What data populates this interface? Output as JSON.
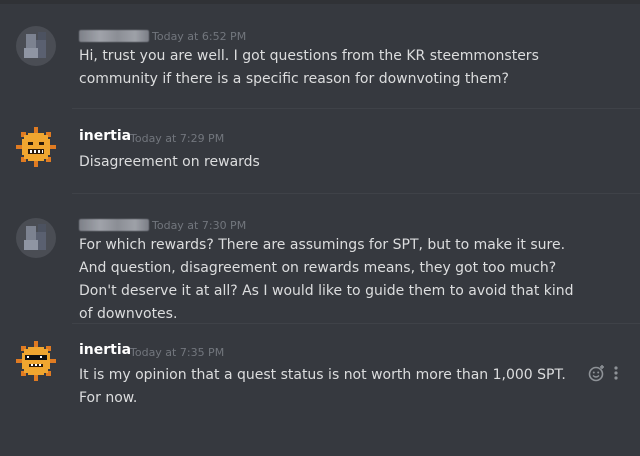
{
  "messages": [
    {
      "author": "",
      "timestamp": "Today at 6:52 PM",
      "lines": [
        "Hi, trust you are well. I got questions from the KR steemmonsters community if there is a specific reason for downvoting them?"
      ]
    },
    {
      "author": "inertia",
      "timestamp": "Today at 7:29 PM",
      "lines": [
        "Disagreement on rewards"
      ]
    },
    {
      "author": "",
      "timestamp": "Today at 7:30 PM",
      "lines": [
        "For which rewards? There are assumings for SPT, but to make it sure.",
        "And question, disagreement on rewards means, they got too much? Don't deserve it at all? As I would like to guide them to avoid that kind of downvotes."
      ]
    },
    {
      "author": "inertia",
      "timestamp": "Today at 7:35 PM",
      "lines": [
        "It is my opinion that a quest status is not worth more than 1,000 SPT.  For now."
      ]
    }
  ],
  "icons": {
    "reaction": "add-reaction-icon",
    "more": "more-options-icon"
  },
  "colors": {
    "background": "#36393f",
    "username": "#ffffff",
    "text": "#dcddde",
    "timestamp": "#72767d",
    "sun_avatar": "#f0a630"
  }
}
